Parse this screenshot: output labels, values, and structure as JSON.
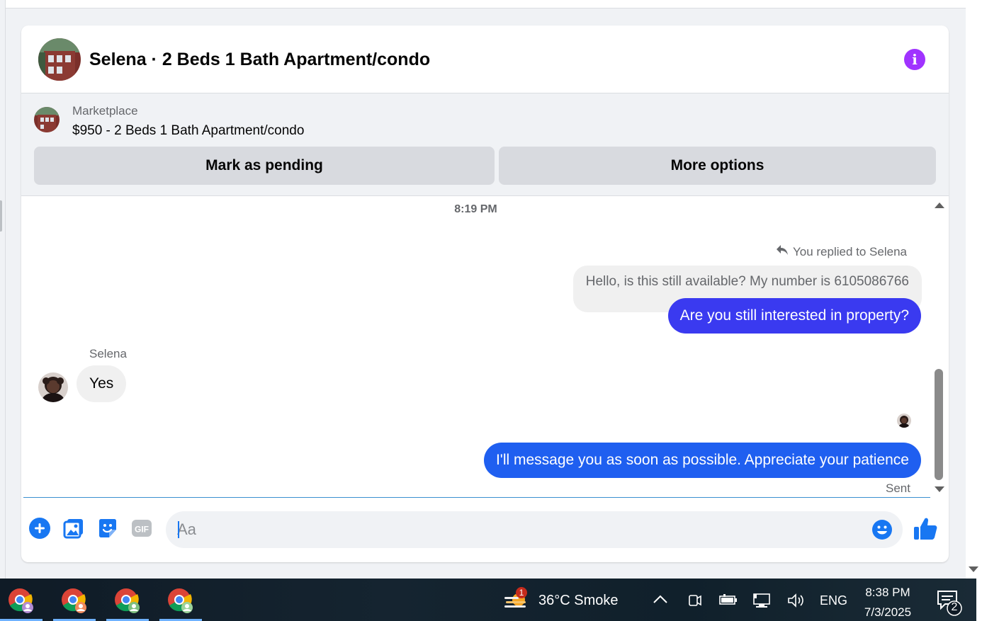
{
  "header": {
    "title": "Selena · 2 Beds 1 Bath Apartment/condo"
  },
  "listing": {
    "source": "Marketplace",
    "title": "$950 - 2 Beds 1 Bath Apartment/condo",
    "mark_pending_label": "Mark as pending",
    "more_options_label": "More options"
  },
  "thread": {
    "timestamp": "8:19 PM",
    "replied_label": "You replied to Selena",
    "quoted_message": "Hello, is this still available? My number is 6105086766",
    "messages": [
      {
        "direction": "outgoing",
        "text": "Are you still interested in property?"
      },
      {
        "direction": "incoming",
        "sender": "Selena",
        "text": "Yes"
      },
      {
        "direction": "outgoing",
        "text": "I'll message you as soon as possible. Appreciate your patience"
      }
    ],
    "status": "Sent"
  },
  "composer": {
    "placeholder": "Aa",
    "tools": [
      "plus-icon",
      "photo-icon",
      "sticker-icon",
      "gif-icon"
    ],
    "emoji_icon": "emoji-icon",
    "send_icon": "thumbs-up-icon"
  },
  "colors": {
    "accent": "#1877f2",
    "info": "#a033ff",
    "outgoing_bubble_1": "#3a3af0",
    "outgoing_bubble_2": "#1f5ff0"
  },
  "taskbar": {
    "apps": [
      "chrome-icon",
      "chrome-icon",
      "chrome-icon",
      "chrome-icon"
    ],
    "weather_badge": "1",
    "weather": "36°C  Smoke",
    "language": "ENG",
    "time": "8:38 PM",
    "date": "7/3/2025",
    "notification_count": "2"
  }
}
